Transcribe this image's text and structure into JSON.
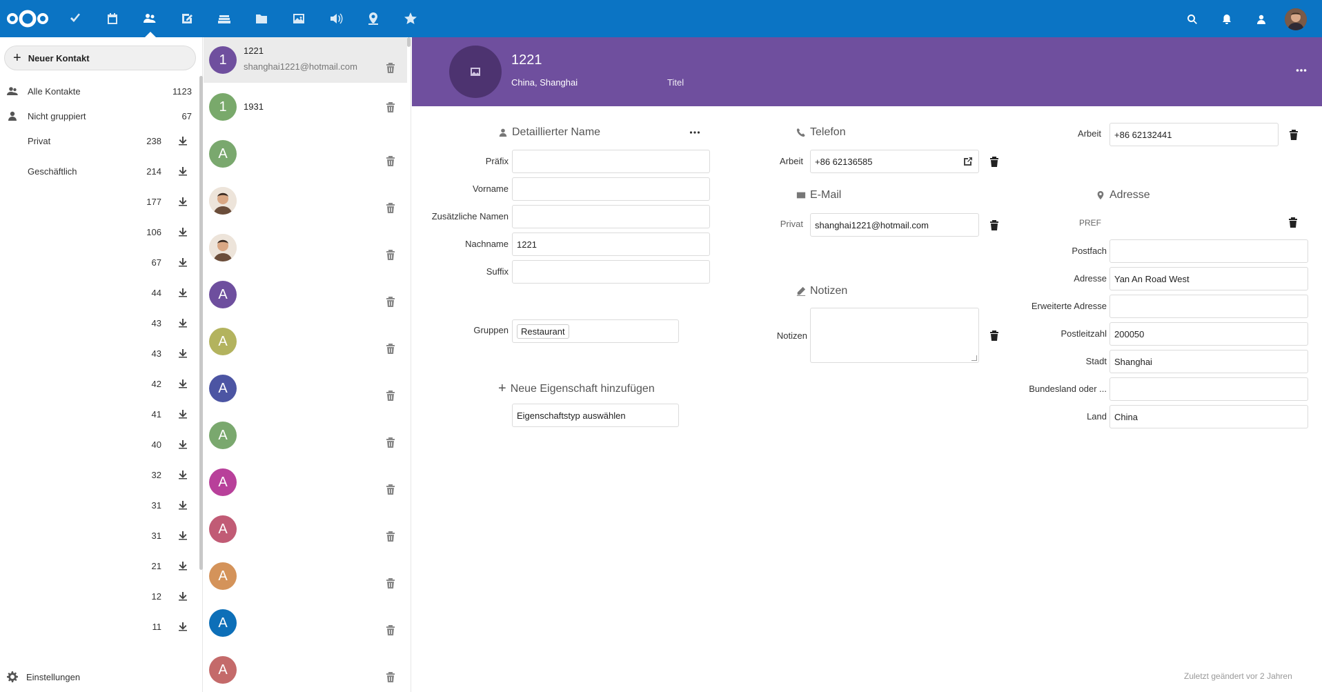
{
  "nav": {
    "new_contact": "Neuer Kontakt",
    "items": [
      {
        "label": "Alle Kontakte",
        "count": "1123",
        "icon": "contacts-icon"
      },
      {
        "label": "Nicht gruppiert",
        "count": "67",
        "icon": "user-icon"
      }
    ],
    "groups": [
      {
        "label": "Privat",
        "count": "238"
      },
      {
        "label": "Geschäftlich",
        "count": "214"
      },
      {
        "label": "",
        "count": "177"
      },
      {
        "label": "",
        "count": "106"
      },
      {
        "label": "",
        "count": "67"
      },
      {
        "label": "",
        "count": "44"
      },
      {
        "label": "",
        "count": "43"
      },
      {
        "label": "",
        "count": "43"
      },
      {
        "label": "",
        "count": "42"
      },
      {
        "label": "",
        "count": "41"
      },
      {
        "label": "",
        "count": "40"
      },
      {
        "label": "",
        "count": "32"
      },
      {
        "label": "",
        "count": "31"
      },
      {
        "label": "",
        "count": "31"
      },
      {
        "label": "",
        "count": "21"
      },
      {
        "label": "",
        "count": "12"
      },
      {
        "label": "",
        "count": "11"
      }
    ],
    "settings": "Einstellungen"
  },
  "contacts": [
    {
      "initial": "1",
      "name": "1221",
      "email": "shanghai1221@hotmail.com",
      "color": "#6f4f9e",
      "photo": false
    },
    {
      "initial": "1",
      "name": "1931",
      "email": "",
      "color": "#79a96b",
      "photo": false
    },
    {
      "initial": "A",
      "name": "",
      "email": "",
      "color": "#7aa86e",
      "photo": false
    },
    {
      "initial": "",
      "name": "",
      "email": "",
      "color": "#e8e0d8",
      "photo": true
    },
    {
      "initial": "",
      "name": "",
      "email": "",
      "color": "#e8e0d8",
      "photo": true
    },
    {
      "initial": "A",
      "name": "",
      "email": "",
      "color": "#6e4f9e",
      "photo": false
    },
    {
      "initial": "A",
      "name": "",
      "email": "",
      "color": "#b3b35e",
      "photo": false
    },
    {
      "initial": "A",
      "name": "",
      "email": "",
      "color": "#4c55a3",
      "photo": false
    },
    {
      "initial": "A",
      "name": "",
      "email": "",
      "color": "#7aa86e",
      "photo": false
    },
    {
      "initial": "A",
      "name": "",
      "email": "",
      "color": "#b8409a",
      "photo": false
    },
    {
      "initial": "A",
      "name": "",
      "email": "",
      "color": "#c15b75",
      "photo": false
    },
    {
      "initial": "A",
      "name": "",
      "email": "",
      "color": "#d4935a",
      "photo": false
    },
    {
      "initial": "A",
      "name": "",
      "email": "",
      "color": "#0d6fb8",
      "photo": false
    },
    {
      "initial": "A",
      "name": "",
      "email": "",
      "color": "#c46a6a",
      "photo": false
    }
  ],
  "header": {
    "name": "1221",
    "location": "China, Shanghai",
    "title": "Titel"
  },
  "name_section": {
    "heading": "Detaillierter Name",
    "fields": [
      {
        "label": "Präfix",
        "value": ""
      },
      {
        "label": "Vorname",
        "value": ""
      },
      {
        "label": "Zusätzliche Namen",
        "value": ""
      },
      {
        "label": "Nachname",
        "value": "1221"
      },
      {
        "label": "Suffix",
        "value": ""
      }
    ]
  },
  "groups_field": {
    "label": "Gruppen",
    "value": "Restaurant"
  },
  "add_property": {
    "label": "Neue Eigenschaft hinzufügen",
    "placeholder": "Eigenschaftstyp auswählen"
  },
  "phone": {
    "heading": "Telefon",
    "label": "Arbeit",
    "value": "+86 62136585",
    "label2": "Arbeit",
    "value2": "+86 62132441"
  },
  "email": {
    "heading": "E-Mail",
    "label": "Privat",
    "value": "shanghai1221@hotmail.com"
  },
  "notes": {
    "heading": "Notizen",
    "label": "Notizen",
    "value": ""
  },
  "address": {
    "heading": "Adresse",
    "pref": "PREF",
    "fields": [
      {
        "label": "Postfach",
        "value": ""
      },
      {
        "label": "Adresse",
        "value": "Yan An Road West"
      },
      {
        "label": "Erweiterte Adresse",
        "value": ""
      },
      {
        "label": "Postleitzahl",
        "value": "200050"
      },
      {
        "label": "Stadt",
        "value": "Shanghai"
      },
      {
        "label": "Bundesland oder ...",
        "value": ""
      },
      {
        "label": "Land",
        "value": "China"
      }
    ]
  },
  "footer": "Zuletzt geändert vor 2 Jahren",
  "colors": {
    "topbar": "#0b74c4",
    "header": "#6f4f9e"
  }
}
